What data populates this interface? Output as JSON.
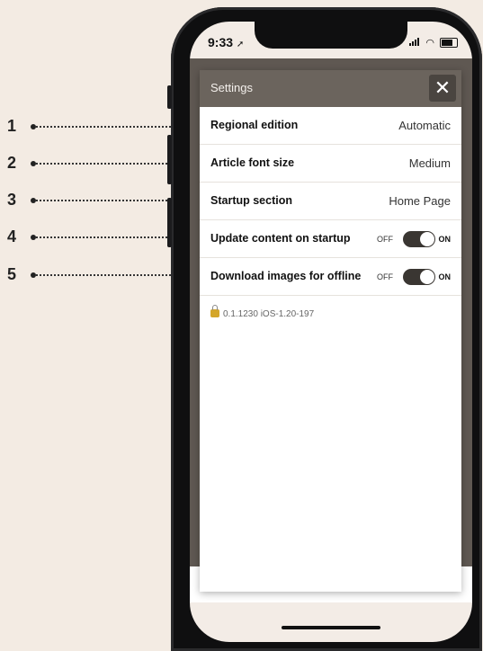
{
  "status_bar": {
    "time": "9:33"
  },
  "settings": {
    "title": "Settings",
    "close_glyph": "✕",
    "rows": [
      {
        "label": "Regional edition",
        "value": "Automatic"
      },
      {
        "label": "Article font size",
        "value": "Medium"
      },
      {
        "label": "Startup section",
        "value": "Home Page"
      },
      {
        "label": "Update content on startup",
        "off_label": "OFF",
        "on_label": "ON",
        "state": "on"
      },
      {
        "label": "Download images for offline",
        "off_label": "OFF",
        "on_label": "ON",
        "state": "on"
      }
    ],
    "version": "0.1.1230 iOS-1.20-197"
  },
  "callouts": [
    "1",
    "2",
    "3",
    "4",
    "5"
  ],
  "colors": {
    "header": "#6b645d",
    "toggle": "#3a3632",
    "page_bg": "#f3ebe3"
  }
}
